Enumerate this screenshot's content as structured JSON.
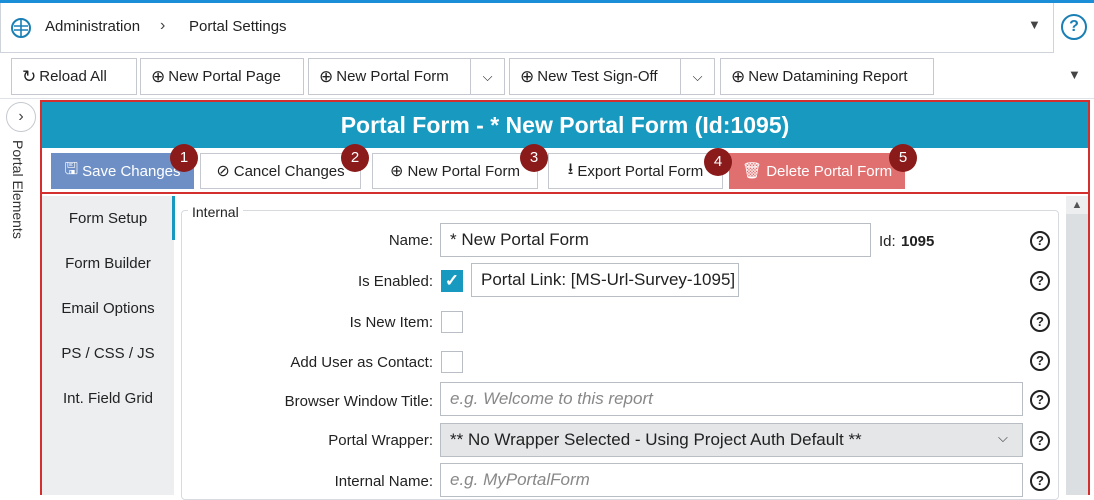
{
  "breadcrumb": {
    "items": [
      "Administration",
      "Portal Settings"
    ]
  },
  "toolbar": {
    "reload_all": "Reload All",
    "new_portal_page": "New Portal Page",
    "new_portal_form": "New Portal Form",
    "new_test_sign_off": "New Test Sign-Off",
    "new_datamining_report": "New Datamining Report"
  },
  "side_panel": {
    "label": "Portal Elements"
  },
  "form": {
    "header": "Portal Form -  * New Portal Form  (Id:1095)",
    "actions": {
      "save": "Save Changes",
      "cancel": "Cancel Changes",
      "new": "New Portal Form",
      "export": "Export Portal Form",
      "delete": "Delete Portal Form"
    },
    "badges": [
      "1",
      "2",
      "3",
      "4",
      "5"
    ]
  },
  "nav": {
    "items": [
      {
        "label": "Form Setup",
        "active": true
      },
      {
        "label": "Form Builder"
      },
      {
        "label": "Email Options"
      },
      {
        "label": "PS / CSS / JS"
      },
      {
        "label": "Int. Field Grid"
      }
    ]
  },
  "fields": {
    "group_title": "Internal",
    "name": {
      "label": "Name:",
      "value": "* New Portal Form",
      "id_label": "Id:",
      "id_value": "1095"
    },
    "is_enabled": {
      "label": "Is Enabled:",
      "checked": true,
      "link": "Portal Link: [MS-Url-Survey-1095]"
    },
    "is_new_item": {
      "label": "Is New Item:",
      "checked": false
    },
    "add_user_as_contact": {
      "label": "Add User as Contact:",
      "checked": false
    },
    "browser_window_title": {
      "label": "Browser Window Title:",
      "placeholder": "e.g. Welcome to this report"
    },
    "portal_wrapper": {
      "label": "Portal Wrapper:",
      "value": "** No Wrapper Selected - Using Project Auth Default **"
    },
    "internal_name": {
      "label": "Internal Name:",
      "placeholder": "e.g. MyPortalForm"
    }
  },
  "colors": {
    "header_bg": "#189ac0",
    "save_bg": "#6e8fc6",
    "delete_bg": "#e07070",
    "badge_bg": "#8b1a1a",
    "highlight_border": "#d32f2f"
  },
  "icons": [
    "app-logo-icon",
    "chevron-right-icon",
    "chevron-down-icon",
    "help-icon",
    "reload-icon",
    "plus-circle-icon",
    "save-icon",
    "cancel-icon",
    "export-icon",
    "trash-icon",
    "check-icon"
  ]
}
